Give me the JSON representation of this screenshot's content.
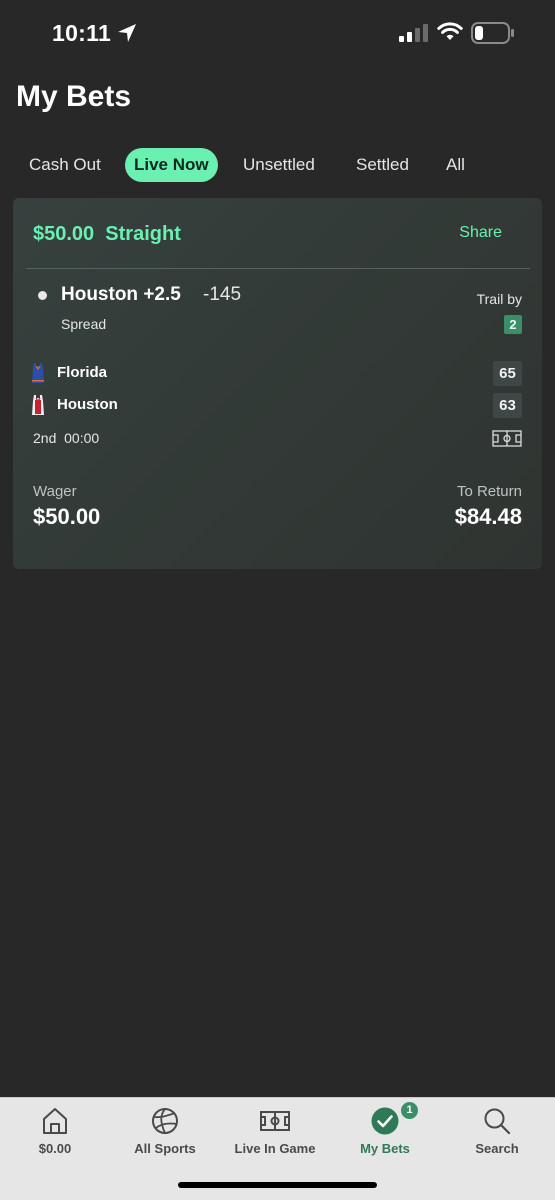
{
  "status_bar": {
    "time": "10:11",
    "icons": [
      "location-arrow-icon",
      "cellular-signal-icon",
      "wifi-icon",
      "battery-icon"
    ]
  },
  "page": {
    "title": "My Bets"
  },
  "tabs": [
    {
      "label": "Cash Out",
      "active": false
    },
    {
      "label": "Live Now",
      "active": true
    },
    {
      "label": "Unsettled",
      "active": false
    },
    {
      "label": "Settled",
      "active": false
    },
    {
      "label": "All",
      "active": false
    }
  ],
  "bet": {
    "stake_amount": "$50.00",
    "bet_type": "Straight",
    "share_label": "Share",
    "selection": "Houston +2.5",
    "odds": "-145",
    "market": "Spread",
    "trail_label": "Trail by",
    "trail_value": "2",
    "teams": [
      {
        "name": "Florida",
        "score": "65",
        "jersey_color": "#2b4fa8"
      },
      {
        "name": "Houston",
        "score": "63",
        "jersey_color": "#c8202e"
      }
    ],
    "period": "2nd",
    "game_clock": "00:00",
    "wager_label": "Wager",
    "wager_value": "$50.00",
    "return_label": "To Return",
    "return_value": "$84.48"
  },
  "bottom_nav": [
    {
      "label": "$0.00",
      "icon": "home-icon",
      "active": false
    },
    {
      "label": "All Sports",
      "icon": "ball-icon",
      "active": false
    },
    {
      "label": "Live In Game",
      "icon": "court-icon",
      "active": false
    },
    {
      "label": "My Bets",
      "icon": "check-circle-icon",
      "active": true,
      "badge": "1"
    },
    {
      "label": "Search",
      "icon": "search-icon",
      "active": false
    }
  ],
  "colors": {
    "background": "#282828",
    "accent": "#6af0b1",
    "badge_green": "#3a8f69",
    "nav_background": "#e6e6e6"
  }
}
